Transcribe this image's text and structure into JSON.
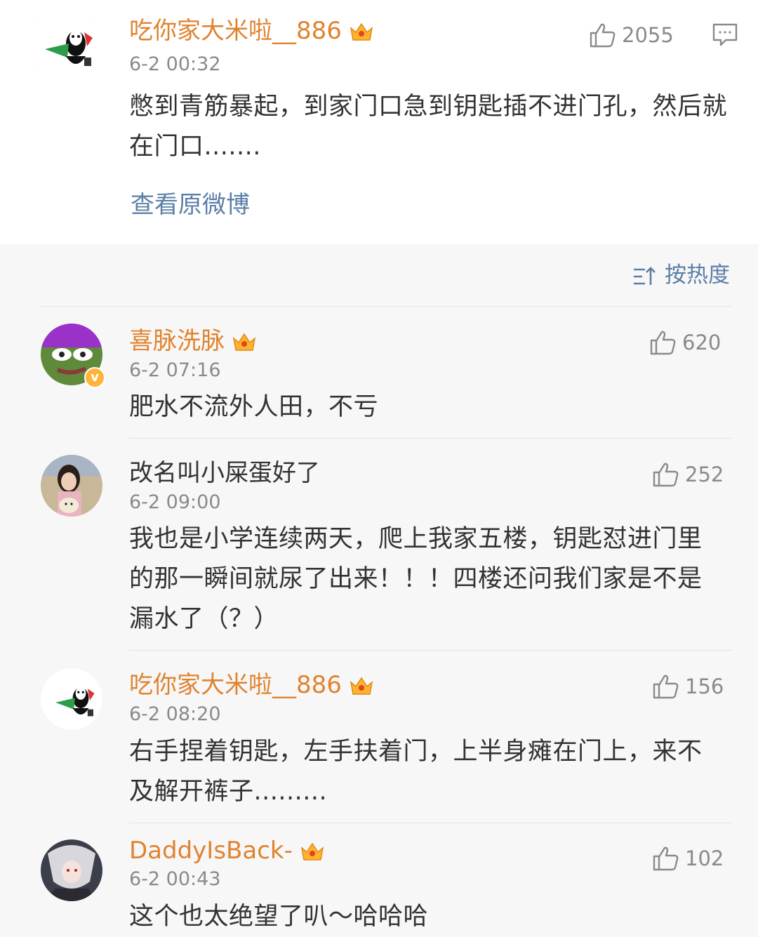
{
  "post": {
    "username": "吃你家大米啦__886",
    "time": "6-2 00:32",
    "likes": "2055",
    "text": "憋到青筋暴起，到家门口急到钥匙插不进门孔，然后就在门口.......",
    "view_original": "查看原微博"
  },
  "sort": {
    "label": "按热度",
    "icon": "sort-icon"
  },
  "comments": [
    {
      "username": "喜脉洗脉",
      "time": "6-2 07:16",
      "likes": "620",
      "text": "肥水不流外人田，不亏",
      "vip": true,
      "verified": true
    },
    {
      "username": "改名叫小屎蛋好了",
      "time": "6-2 09:00",
      "likes": "252",
      "text": "我也是小学连续两天，爬上我家五楼，钥匙怼进门里的那一瞬间就尿了出来！！！四楼还问我们家是不是漏水了（？）",
      "vip": false
    },
    {
      "username": "吃你家大米啦__886",
      "time": "6-2 08:20",
      "likes": "156",
      "text": "右手捏着钥匙，左手扶着门，上半身瘫在门上，来不及解开裤子.........",
      "vip": true
    },
    {
      "username": "DaddyIsBack-",
      "time": "6-2 00:43",
      "likes": "102",
      "text": "这个也太绝望了叭～哈哈哈",
      "vip": true
    }
  ],
  "colors": {
    "username": "#e0832f",
    "link": "#5b7fa6",
    "meta": "#8a8a8a",
    "body": "#333333"
  }
}
